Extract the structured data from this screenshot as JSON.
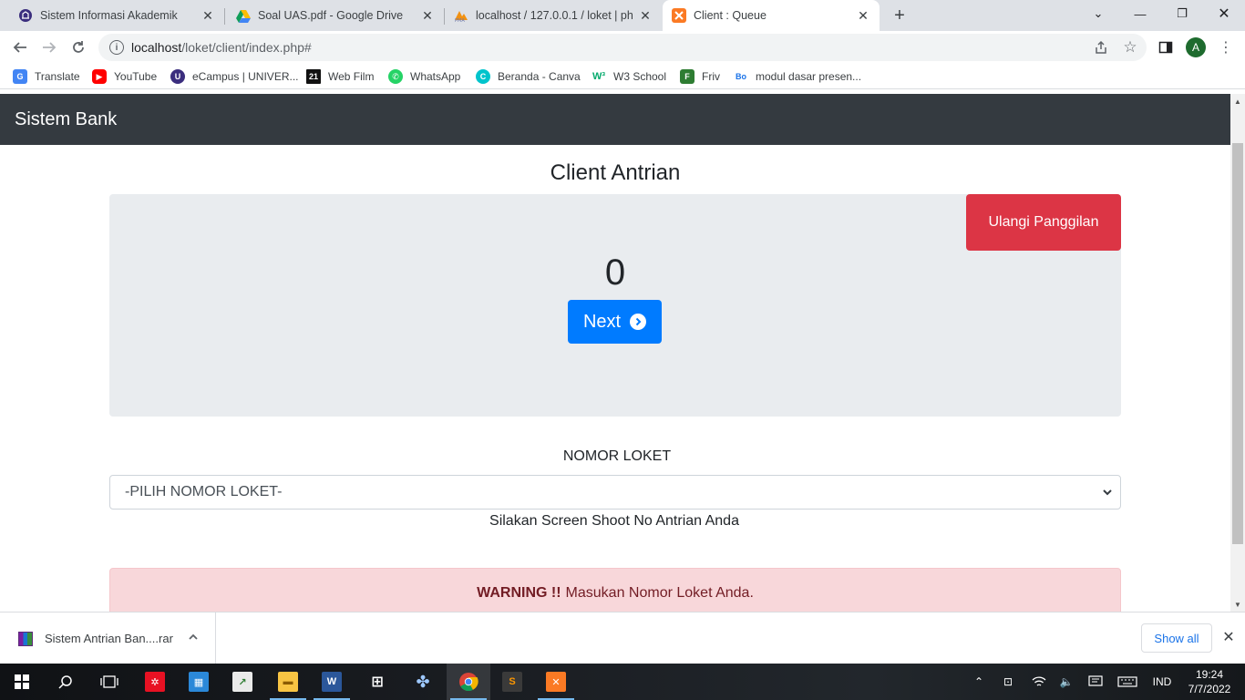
{
  "browser": {
    "tabs": [
      {
        "title": "Sistem Informasi Akademik",
        "favicon": "university-icon"
      },
      {
        "title": "Soal UAS.pdf - Google Drive",
        "favicon": "google-drive-icon"
      },
      {
        "title": "localhost / 127.0.0.1 / loket | php",
        "favicon": "phpmyadmin-icon"
      },
      {
        "title": "Client : Queue",
        "favicon": "xampp-icon"
      }
    ],
    "url_host": "localhost",
    "url_path": "/loket/client/index.php#",
    "profile_initial": "A",
    "bookmarks": [
      {
        "label": "Translate"
      },
      {
        "label": "YouTube"
      },
      {
        "label": "eCampus | UNIVER..."
      },
      {
        "label": "Web Film"
      },
      {
        "label": "WhatsApp"
      },
      {
        "label": "Beranda - Canva"
      },
      {
        "label": "W3 School"
      },
      {
        "label": "Friv"
      },
      {
        "label": "modul dasar presen..."
      }
    ]
  },
  "app": {
    "brand": "Sistem Bank",
    "page_title": "Client Antrian",
    "recall_button": "Ulangi Panggilan",
    "queue_number": "0",
    "next_button": "Next",
    "loket_label": "NOMOR LOKET",
    "loket_select_value": "-PILIH NOMOR LOKET-",
    "hint": "Silakan Screen Shoot No Antrian Anda",
    "alert_strong": "WARNING !!",
    "alert_text": "Masukan Nomor Loket Anda.",
    "colors": {
      "navbar": "#343a40",
      "danger": "#dc3545",
      "primary": "#007bff",
      "alert_bg": "#f8d7da"
    }
  },
  "downloads": {
    "file": "Sistem Antrian Ban....rar",
    "show_all": "Show all"
  },
  "taskbar": {
    "language": "IND",
    "time": "19:24",
    "date": "7/7/2022"
  }
}
